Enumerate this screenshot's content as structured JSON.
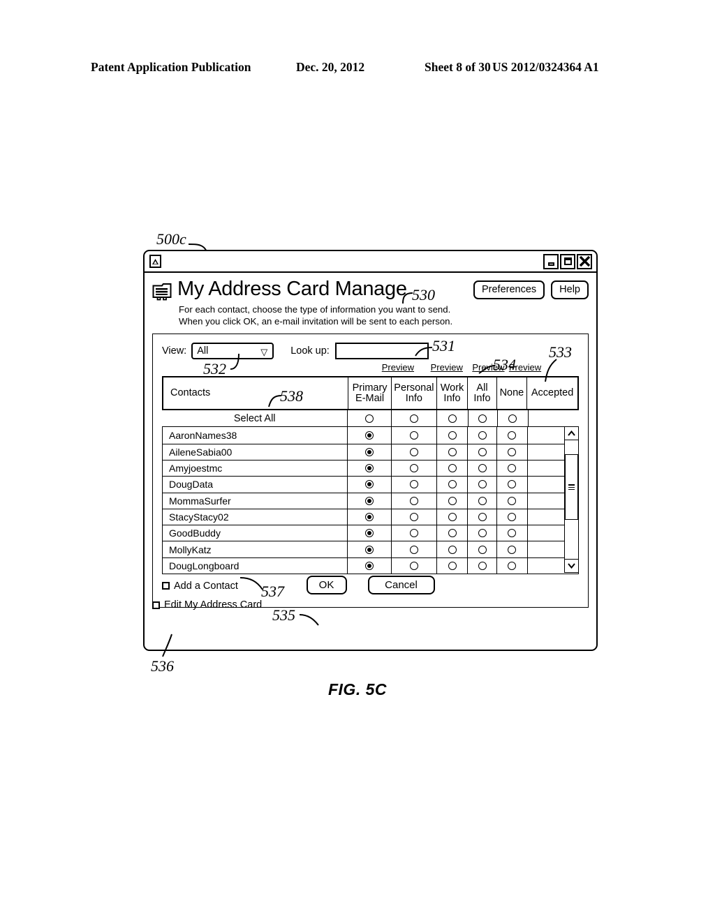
{
  "page_header": {
    "publication": "Patent Application Publication",
    "date": "Dec. 20, 2012",
    "sheet": "Sheet 8 of 30",
    "pub_number": "US 2012/0324364 A1"
  },
  "figure": {
    "caption": "FIG. 5C",
    "refs": {
      "window": "500c",
      "title": "530",
      "lookup": "531",
      "view_select": "532",
      "accepted_col": "533",
      "preview_links": "534",
      "ok_button": "535",
      "edit_my_address_card": "536",
      "add_a_contact": "537",
      "contacts_col": "538"
    }
  },
  "window": {
    "app_icon": "mountain-app-icon",
    "controls": {
      "minimize": "minimize-icon",
      "maximize": "maximize-icon",
      "close": "✕"
    },
    "title": "My Address Card Manage",
    "title_icon": "address-card-icon",
    "subtitle": "For each contact, choose the type of information you want to send.\nWhen you click OK, an e-mail invitation will be sent to each person.",
    "header_buttons": [
      {
        "label": "Preferences"
      },
      {
        "label": "Help"
      }
    ]
  },
  "filters": {
    "view_label": "View:",
    "view_value": "All",
    "view_caret": "▽",
    "lookup_label": "Look up:",
    "lookup_value": "",
    "lookup_placeholder": ""
  },
  "preview_links": [
    {
      "label": "Preview"
    },
    {
      "label": "Preview"
    },
    {
      "label": "Preview"
    },
    {
      "label": "Preview"
    }
  ],
  "table": {
    "columns": [
      {
        "key": "contacts",
        "label": "Contacts"
      },
      {
        "key": "primary_email",
        "label": "Primary\nE-Mail"
      },
      {
        "key": "personal_info",
        "label": "Personal\nInfo"
      },
      {
        "key": "work_info",
        "label": "Work\nInfo"
      },
      {
        "key": "all_info",
        "label": "All\nInfo"
      },
      {
        "key": "none",
        "label": "None"
      },
      {
        "key": "accepted",
        "label": "Accepted"
      }
    ],
    "select_all_label": "Select All",
    "select_all_selected": null,
    "rows": [
      {
        "name": "AaronNames38",
        "selected": "primary_email",
        "accepted": ""
      },
      {
        "name": "AileneSabia00",
        "selected": "primary_email",
        "accepted": ""
      },
      {
        "name": "Amyjoestmc",
        "selected": "primary_email",
        "accepted": ""
      },
      {
        "name": "DougData",
        "selected": "primary_email",
        "accepted": ""
      },
      {
        "name": "MommaSurfer",
        "selected": "primary_email",
        "accepted": ""
      },
      {
        "name": "StacyStacy02",
        "selected": "primary_email",
        "accepted": ""
      },
      {
        "name": "GoodBuddy",
        "selected": "primary_email",
        "accepted": ""
      },
      {
        "name": "MollyKatz",
        "selected": "primary_email",
        "accepted": ""
      },
      {
        "name": "DougLongboard",
        "selected": "primary_email",
        "accepted": ""
      }
    ],
    "scrollbar": {
      "up_arrow": "⌃",
      "down_arrow": "⌄"
    }
  },
  "footer": {
    "add_contact_label": "Add a Contact",
    "add_contact_checked": false,
    "ok_label": "OK",
    "cancel_label": "Cancel",
    "edit_card_label": "Edit My Address Card",
    "edit_card_checked": false
  }
}
